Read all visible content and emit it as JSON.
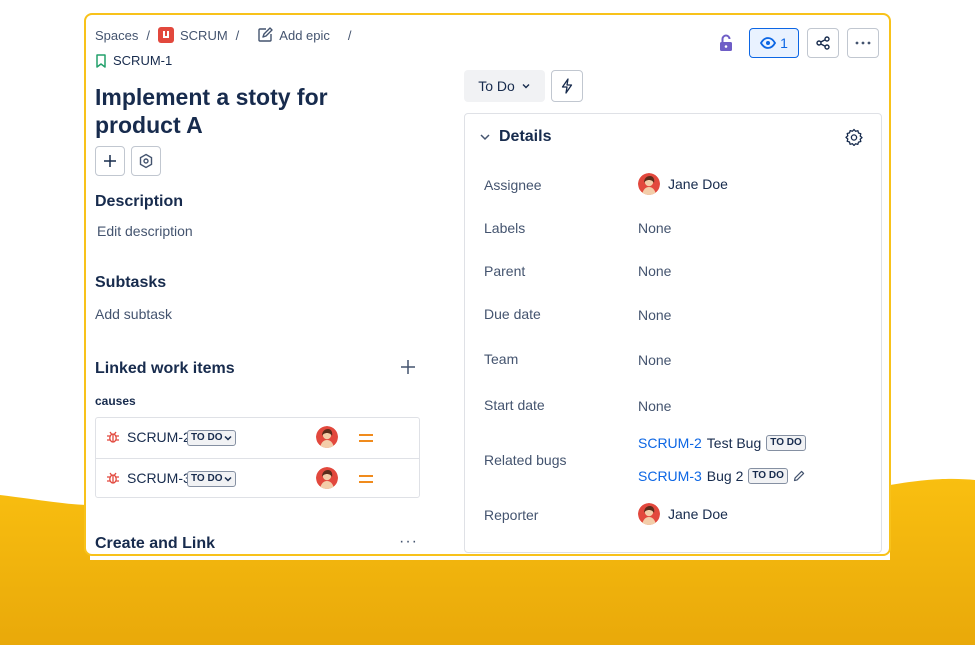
{
  "colors": {
    "accent": "#0c66e4",
    "panel_border": "#f8c21a",
    "background_wave": "#f5b700",
    "lock": "#6e5dc6",
    "bug": "#e2483d",
    "priority": "#f08b1d"
  },
  "breadcrumb": {
    "spaces": "Spaces",
    "project": "SCRUM",
    "add_epic": "Add epic",
    "issue_key": "SCRUM-1",
    "separator": "/"
  },
  "header": {
    "watch_count": "1",
    "icons": [
      "lock-icon",
      "eye-icon",
      "share-icon",
      "more-icon"
    ]
  },
  "issue": {
    "title": "Implement a stoty for product A",
    "status": "To Do"
  },
  "description": {
    "heading": "Description",
    "placeholder": "Edit description"
  },
  "subtasks": {
    "heading": "Subtasks",
    "placeholder": "Add subtask"
  },
  "linked": {
    "heading": "Linked work items",
    "relation": "causes",
    "rows": [
      {
        "key": "SCRUM-2",
        "status": "TO DO"
      },
      {
        "key": "SCRUM-3",
        "status": "TO DO"
      }
    ]
  },
  "create_link": {
    "heading": "Create and Link",
    "more": "···"
  },
  "details": {
    "heading": "Details",
    "fields": {
      "assignee": {
        "label": "Assignee",
        "value": "Jane Doe"
      },
      "labels": {
        "label": "Labels",
        "value": "None"
      },
      "parent": {
        "label": "Parent",
        "value": "None"
      },
      "due_date": {
        "label": "Due date",
        "value": "None"
      },
      "team": {
        "label": "Team",
        "value": "None"
      },
      "start_date": {
        "label": "Start date",
        "value": "None"
      },
      "related_bugs": {
        "label": "Related bugs",
        "items": [
          {
            "key": "SCRUM-2",
            "name": "Test Bug",
            "status": "TO DO"
          },
          {
            "key": "SCRUM-3",
            "name": "Bug 2",
            "status": "TO DO"
          }
        ]
      },
      "reporter": {
        "label": "Reporter",
        "value": "Jane Doe"
      }
    }
  }
}
